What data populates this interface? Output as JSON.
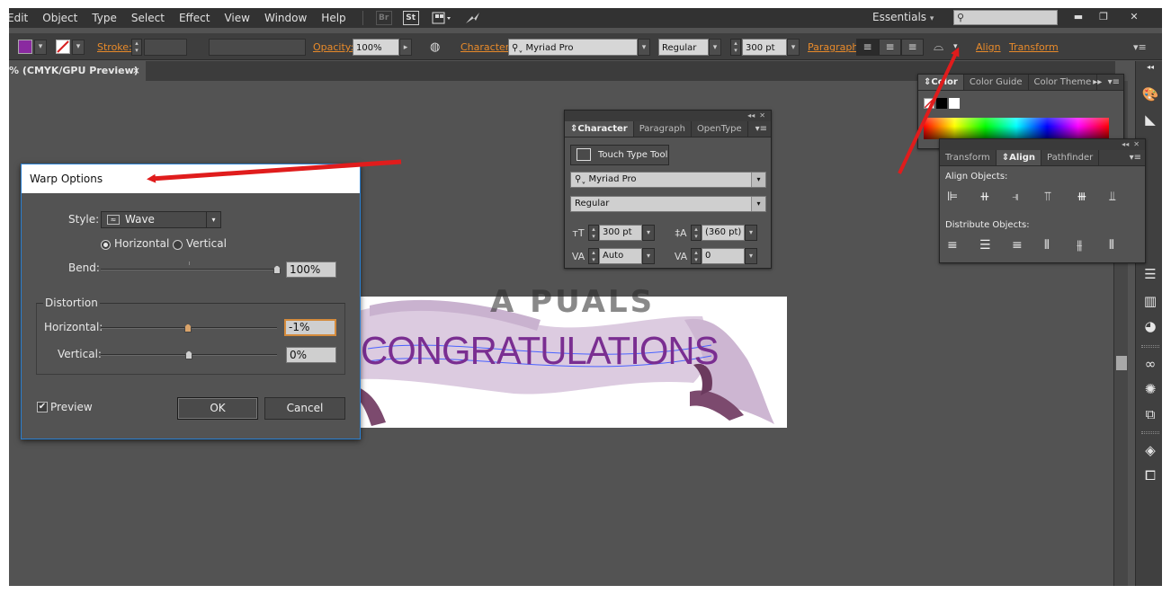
{
  "menu": [
    "Edit",
    "Object",
    "Type",
    "Select",
    "Effect",
    "View",
    "Window",
    "Help"
  ],
  "menu_icons": {
    "bridge": "Br",
    "stock": "St"
  },
  "workspace": "Essentials",
  "workspace_arrow": "▾",
  "window_controls": {
    "minimize": "▬",
    "restore": "❐",
    "close": "✕"
  },
  "controlbar": {
    "stroke_label": "Stroke:",
    "opacity_label": "Opacity:",
    "opacity_value": "100%",
    "character_label": "Character:",
    "font_name": "Myriad Pro",
    "font_style": "Regular",
    "font_size": "300 pt",
    "paragraph_label": "Paragraph:",
    "align_label": "Align",
    "transform_label": "Transform",
    "fill_color": "#8a2aa0",
    "stroke_color": "#d62020"
  },
  "document_tab": {
    "title": "% (CMYK/GPU Preview)",
    "close": "×"
  },
  "artwork": {
    "text": "CONGRATULATIONS",
    "text_color": "#7a2e91"
  },
  "watermark": "A  PUALS",
  "character_panel": {
    "tabs": [
      "Character",
      "Paragraph",
      "OpenType"
    ],
    "touch_type_label": "Touch Type Tool",
    "font": "Myriad Pro",
    "style": "Regular",
    "size": "300 pt",
    "leading": "(360 pt)",
    "kerning": "Auto",
    "tracking": "0"
  },
  "color_panel": {
    "tabs": [
      "Color",
      "Color Guide",
      "Color Theme"
    ]
  },
  "align_panel": {
    "tabs": [
      "Transform",
      "Align",
      "Pathfinder"
    ],
    "align_objects_label": "Align Objects:",
    "distribute_objects_label": "Distribute Objects:"
  },
  "warp": {
    "title": "Warp Options",
    "style_label": "Style:",
    "style_value": "Wave",
    "horizontal_label": "Horizontal",
    "vertical_label": "Vertical",
    "orientation_selected": "Horizontal",
    "bend_label": "Bend:",
    "bend_value": "100%",
    "bend_fraction": 1.0,
    "distortion_label": "Distortion",
    "dist_horizontal_label": "Horizontal:",
    "dist_horizontal_value": "-1%",
    "dist_horizontal_fraction": -0.01,
    "dist_vertical_label": "Vertical:",
    "dist_vertical_value": "0%",
    "dist_vertical_fraction": 0.0,
    "preview_label": "Preview",
    "preview_checked": true,
    "ok_label": "OK",
    "cancel_label": "Cancel"
  },
  "colors": {
    "annotation_arrow": "#e01c1c",
    "accent_link": "#e88a2a"
  }
}
